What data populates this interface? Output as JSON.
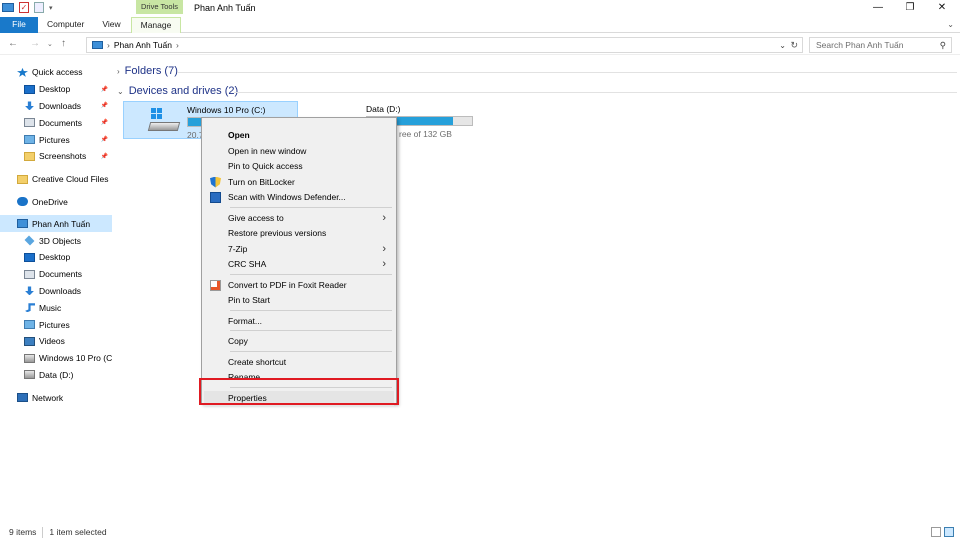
{
  "window": {
    "contextual_tab_group": "Drive Tools",
    "title": "Phan Anh Tuấn"
  },
  "ribbon": {
    "tabs": [
      "File",
      "Computer",
      "View",
      "Manage"
    ]
  },
  "address_bar": {
    "path": [
      "Phan Anh Tuấn"
    ],
    "search_placeholder": "Search Phan Anh Tuấn"
  },
  "nav_pane": {
    "items": [
      {
        "label": "Quick access",
        "icon": "star-icon",
        "indent": 0,
        "pinned": false
      },
      {
        "label": "Desktop",
        "icon": "desktop-folder-icon",
        "indent": 1,
        "pinned": true
      },
      {
        "label": "Downloads",
        "icon": "download-arrow-icon",
        "indent": 1,
        "pinned": true
      },
      {
        "label": "Documents",
        "icon": "documents-icon",
        "indent": 1,
        "pinned": true
      },
      {
        "label": "Pictures",
        "icon": "pictures-icon",
        "indent": 1,
        "pinned": true
      },
      {
        "label": "Screenshots",
        "icon": "folder-icon",
        "indent": 1,
        "pinned": true
      },
      {
        "label": "Creative Cloud Files",
        "icon": "folder-icon",
        "indent": 0,
        "pinned": false
      },
      {
        "label": "OneDrive",
        "icon": "cloud-icon",
        "indent": 0,
        "pinned": false
      },
      {
        "label": "Phan Anh Tuấn",
        "icon": "computer-icon",
        "indent": 0,
        "pinned": false,
        "selected": true
      },
      {
        "label": "3D Objects",
        "icon": "3d-objects-icon",
        "indent": 1,
        "pinned": false
      },
      {
        "label": "Desktop",
        "icon": "desktop-folder-icon",
        "indent": 1,
        "pinned": false
      },
      {
        "label": "Documents",
        "icon": "documents-icon",
        "indent": 1,
        "pinned": false
      },
      {
        "label": "Downloads",
        "icon": "download-arrow-icon",
        "indent": 1,
        "pinned": false
      },
      {
        "label": "Music",
        "icon": "music-icon",
        "indent": 1,
        "pinned": false
      },
      {
        "label": "Pictures",
        "icon": "pictures-icon",
        "indent": 1,
        "pinned": false
      },
      {
        "label": "Videos",
        "icon": "videos-icon",
        "indent": 1,
        "pinned": false
      },
      {
        "label": "Windows 10 Pro (C:",
        "icon": "windows-drive-icon",
        "indent": 1,
        "pinned": false
      },
      {
        "label": "Data (D:)",
        "icon": "drive-icon",
        "indent": 1,
        "pinned": false
      },
      {
        "label": "Network",
        "icon": "network-icon",
        "indent": 0,
        "pinned": false
      }
    ]
  },
  "content": {
    "folders_group": "Folders (7)",
    "drives_group": "Devices and drives (2)",
    "drives": [
      {
        "name": "Windows 10 Pro (C:)",
        "free_text": "20.7",
        "used_fraction": 0.82
      },
      {
        "name": "Data (D:)",
        "free_text": "ree of 132 GB",
        "used_fraction": 0.82
      }
    ]
  },
  "context_menu": {
    "items": [
      {
        "label": "Open",
        "bold": true,
        "icon": "",
        "submenu": false
      },
      {
        "label": "Open in new window",
        "icon": "",
        "submenu": false
      },
      {
        "label": "Pin to Quick access",
        "icon": "",
        "submenu": false
      },
      {
        "label": "Turn on BitLocker",
        "icon": "shield-icon",
        "submenu": false
      },
      {
        "label": "Scan with Windows Defender...",
        "icon": "defender-icon",
        "submenu": false
      },
      {
        "label": "Give access to",
        "icon": "",
        "submenu": true
      },
      {
        "label": "Restore previous versions",
        "icon": "",
        "submenu": false
      },
      {
        "label": "7-Zip",
        "icon": "",
        "submenu": true
      },
      {
        "label": "CRC SHA",
        "icon": "",
        "submenu": true
      },
      {
        "label": "Convert to PDF in Foxit Reader",
        "icon": "foxit-icon",
        "submenu": false
      },
      {
        "label": "Pin to Start",
        "icon": "",
        "submenu": false
      },
      {
        "label": "Format...",
        "icon": "",
        "submenu": false
      },
      {
        "label": "Copy",
        "icon": "",
        "submenu": false
      },
      {
        "label": "Create shortcut",
        "icon": "",
        "submenu": false
      },
      {
        "label": "Rename",
        "icon": "",
        "submenu": false
      },
      {
        "label": "Properties",
        "icon": "",
        "submenu": false,
        "highlighted": true
      }
    ]
  },
  "status_bar": {
    "items_count": "9 items",
    "selection": "1 item selected"
  },
  "colors": {
    "accent": "#1979ca",
    "selection": "#cce8ff",
    "highlight_box": "#e01a22",
    "drive_bar": "#26a0da",
    "contextual_tab": "#c8e6a3",
    "group_header": "#1e3287"
  }
}
